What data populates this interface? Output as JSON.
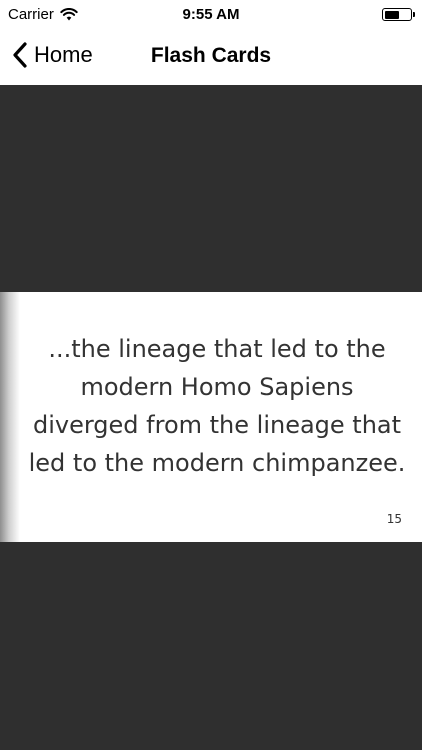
{
  "status_bar": {
    "carrier": "Carrier",
    "time": "9:55 AM",
    "battery_level": 0.6,
    "icons": [
      "wifi-icon",
      "battery-icon"
    ]
  },
  "nav_bar": {
    "back_label": "Home",
    "title": "Flash Cards",
    "icons": [
      "chevron-left-icon"
    ]
  },
  "card": {
    "text": "...the lineage that led to the modern Homo Sapiens diverged from the lineage that led to the modern chimpanzee.",
    "number": "15"
  },
  "colors": {
    "background": "#2f2f2f",
    "card": "#ffffff",
    "text": "#333333"
  }
}
